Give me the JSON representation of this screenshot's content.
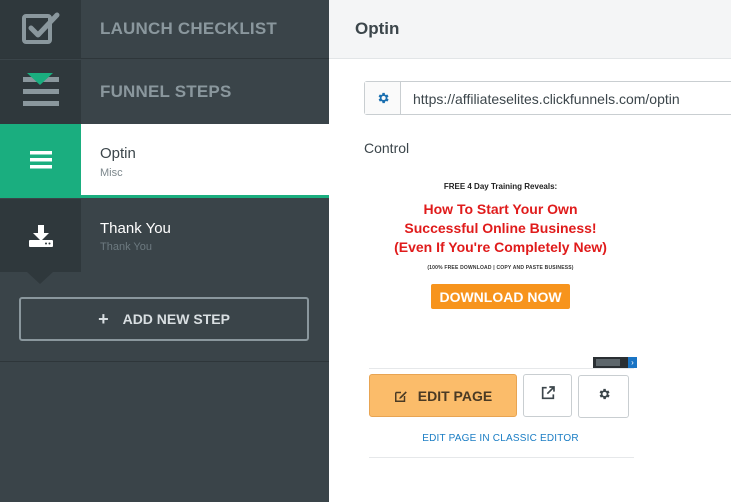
{
  "sidebar": {
    "launch_checklist": "LAUNCH CHECKLIST",
    "funnel_steps": "FUNNEL STEPS",
    "steps": [
      {
        "title": "Optin",
        "subtitle": "Misc"
      },
      {
        "title": "Thank You",
        "subtitle": "Thank You"
      }
    ],
    "add_new_step": "ADD NEW STEP",
    "add_icon": "+"
  },
  "main": {
    "title": "Optin",
    "url": "https://affiliateselites.clickfunnels.com/optin",
    "control_label": "Control",
    "preview": {
      "top_line": "FREE 4 Day Training Reveals:",
      "headline": "How To Start Your Own Successful Online Business! (Even If You're Completely New)",
      "small_line": "(100% FREE DOWNLOAD | COPY AND PASTE BUSINESS)",
      "button": "DOWNLOAD NOW",
      "badge_arrow": "›"
    },
    "edit_page": "EDIT PAGE",
    "classic_editor": "EDIT PAGE IN CLASSIC EDITOR"
  },
  "colors": {
    "sidebar_bg": "#3a4449",
    "active_green": "#1aae7f",
    "edit_orange": "#fbbc6a",
    "headline_red": "#e01b1b",
    "link_blue": "#1a7dc4"
  },
  "icons": {
    "launch": "checkbox-check-icon",
    "funnel": "bars-icon",
    "optin": "list-bars-icon",
    "thankyou": "download-tray-icon",
    "url": "gear-icon",
    "edit": "pencil-square-icon",
    "external": "external-link-icon",
    "settings": "gear-icon"
  }
}
